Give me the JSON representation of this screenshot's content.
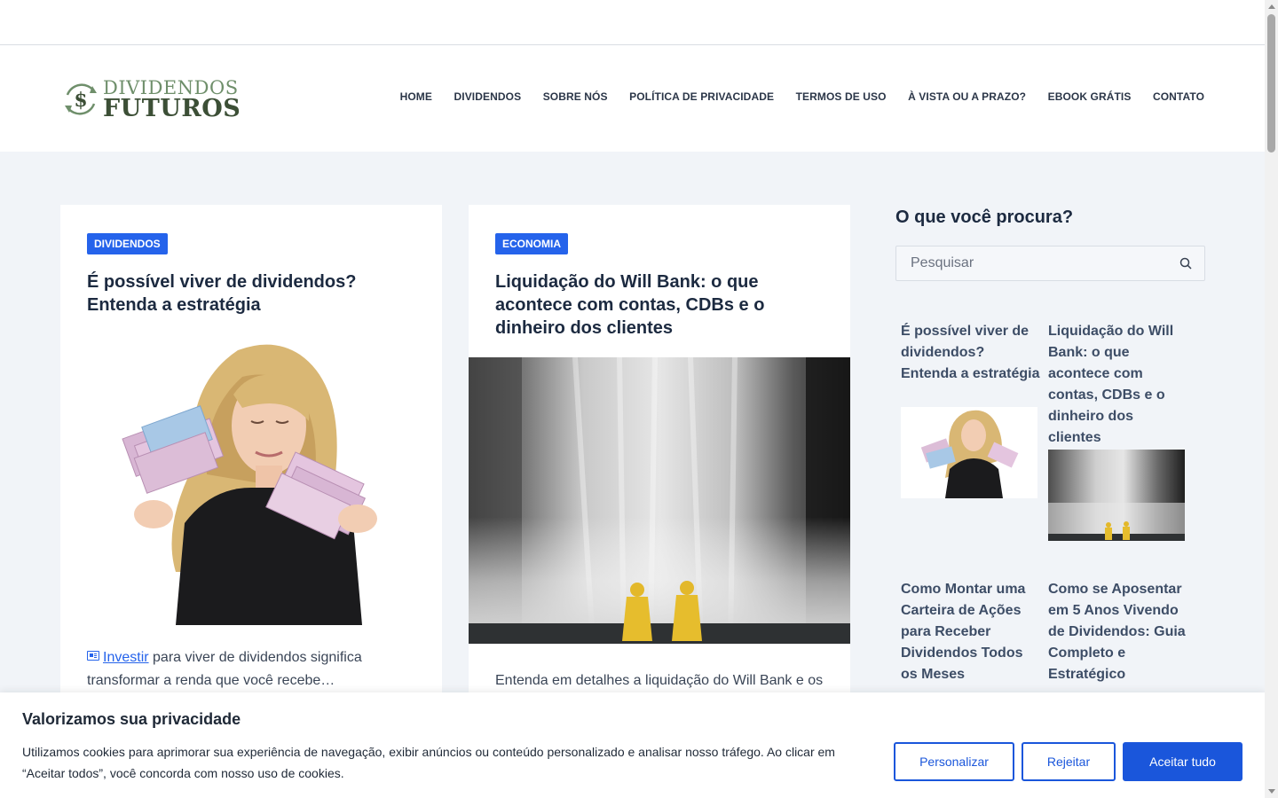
{
  "site": {
    "logo_line1": "DIVIDENDOS",
    "logo_line2": "FUTUROS"
  },
  "nav": {
    "items": [
      "HOME",
      "DIVIDENDOS",
      "SOBRE NÓS",
      "POLÍTICA DE PRIVACIDADE",
      "TERMOS DE USO",
      "À VISTA OU A PRAZO?",
      "EBOOK GRÁTIS",
      "CONTATO"
    ]
  },
  "posts": [
    {
      "category": "DIVIDENDOS",
      "title": "É possível viver de dividendos? Entenda a estratégia",
      "excerpt_link": "Investir",
      "excerpt": " para viver de dividendos significa transformar a renda que você recebe…"
    },
    {
      "category": "ECONOMIA",
      "title": "Liquidação do Will Bank: o que acontece com contas, CDBs e o dinheiro dos clientes",
      "excerpt": "Entenda em detalhes a liquidação do Will Bank e os"
    }
  ],
  "sidebar": {
    "title": "O que você procura?",
    "search_placeholder": "Pesquisar",
    "recent_posts": [
      "É possível viver de dividendos? Entenda a estratégia",
      "Liquidação do Will Bank: o que acontece com contas, CDBs e o dinheiro dos clientes",
      "Como Montar uma Carteira de Ações para Receber Dividendos Todos os Meses",
      "Como se Aposentar em 5 Anos Vivendo de Dividendos: Guia Completo e Estratégico"
    ]
  },
  "cookie_banner": {
    "title": "Valorizamos sua privacidade",
    "text": "Utilizamos cookies para aprimorar sua experiência de navegação, exibir anúncios ou conteúdo personalizado e analisar nosso tráfego. Ao clicar em “Aceitar todos”, você concorda com nosso uso de cookies.",
    "customize_label": "Personalizar",
    "reject_label": "Rejeitar",
    "accept_label": "Aceitar tudo"
  },
  "colors": {
    "accent": "#2563eb",
    "logo_green_light": "#6f8f6b",
    "logo_green_dark": "#3c4f36",
    "page_background": "#f1f4f8"
  }
}
